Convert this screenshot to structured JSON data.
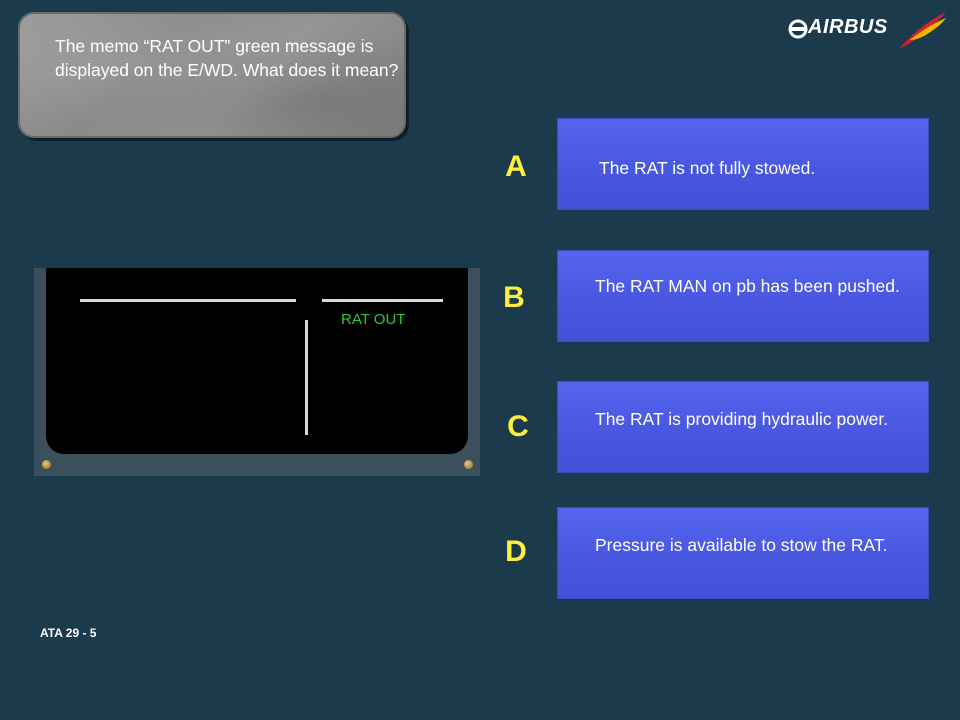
{
  "question": {
    "text": "The memo “RAT OUT” green message is displayed on the E/WD. What does it mean?"
  },
  "brand": {
    "name": "AIRBUS"
  },
  "options": [
    {
      "letter": "A",
      "text": "The RAT is not fully stowed."
    },
    {
      "letter": "B",
      "text": "The RAT MAN on pb has been pushed."
    },
    {
      "letter": "C",
      "text": "The RAT is providing hydraulic power."
    },
    {
      "letter": "D",
      "text": "Pressure is available to stow the RAT."
    }
  ],
  "ewd": {
    "memo": "RAT OUT",
    "memo_color": "#33c833"
  },
  "footer": {
    "ata": "ATA 29 - 5"
  },
  "colors": {
    "background": "#1b3a4b",
    "option_blue": "#4a58e2",
    "letter_yellow": "#ffef3a"
  }
}
